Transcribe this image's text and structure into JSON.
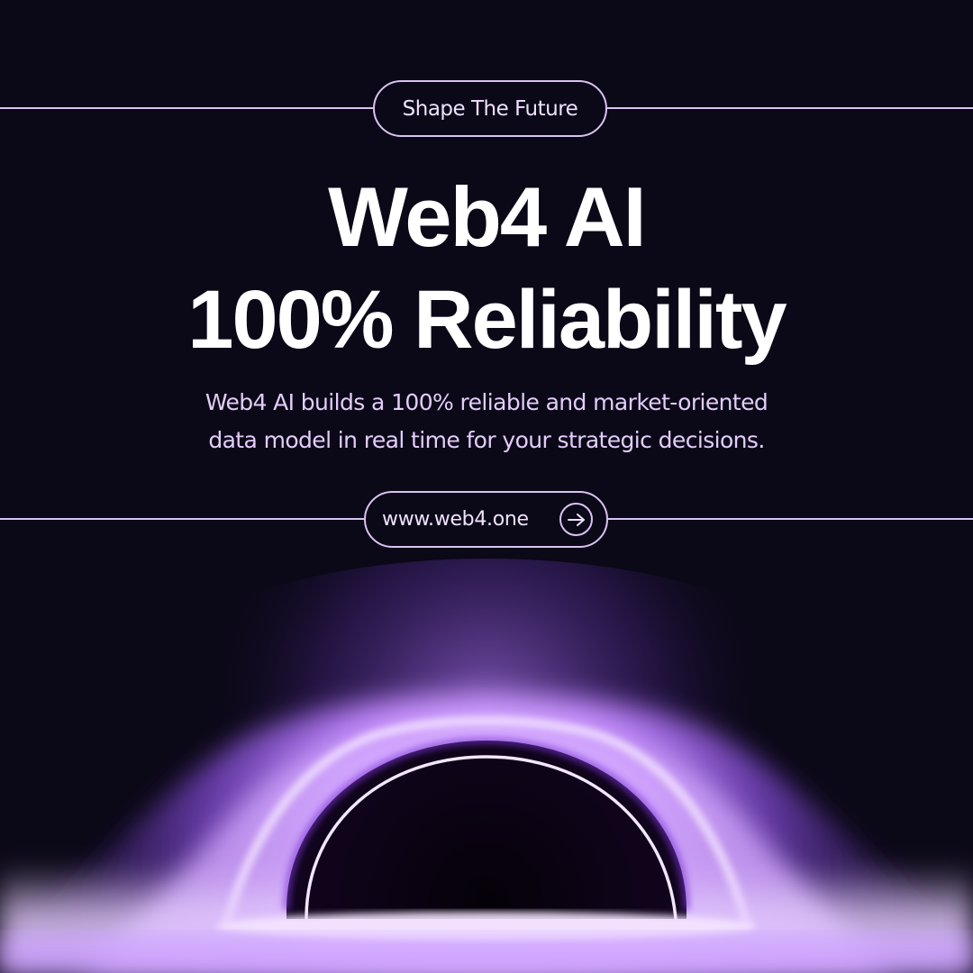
{
  "tagline": "Shape The Future",
  "headline": {
    "line1": "Web4 AI",
    "line2": "100% Reliability"
  },
  "description": {
    "line1": "Web4 AI builds a 100% reliable and market-oriented",
    "line2": "data model in real time for your strategic decisions."
  },
  "cta": {
    "url_label": "www.web4.one",
    "icon": "arrow-right-icon"
  },
  "colors": {
    "background": "#0b0817",
    "accent": "#d9c3f2",
    "glow": "#a66cf5",
    "text": "#ffffff"
  }
}
